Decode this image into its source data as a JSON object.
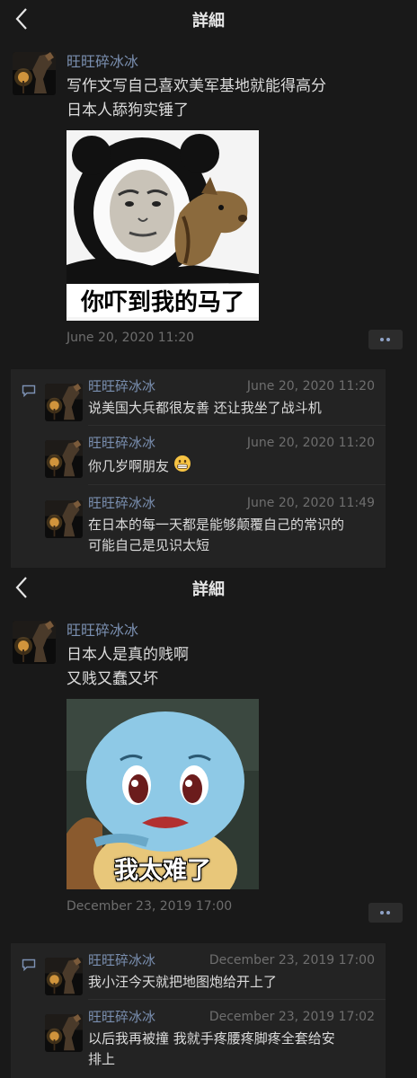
{
  "screens": [
    {
      "nav": {
        "title": "詳細"
      },
      "post": {
        "author": "旺旺碎冰冰",
        "text": [
          "写作文写自己喜欢美军基地就能得高分",
          "日本人舔狗实锤了"
        ],
        "image_caption": "你吓到我的马了",
        "date": "June 20, 2020 11:20"
      },
      "comments": [
        {
          "author": "旺旺碎冰冰",
          "date": "June 20, 2020 11:20",
          "text": [
            "说美国大兵都很友善 还让我坐了战斗机"
          ]
        },
        {
          "author": "旺旺碎冰冰",
          "date": "June 20, 2020 11:20",
          "text": [
            "你几岁啊朋友"
          ],
          "emoji": "grin-emoji"
        },
        {
          "author": "旺旺碎冰冰",
          "date": "June 20, 2020 11:49",
          "text": [
            "在日本的每一天都是能够颠覆自己的常识的",
            "可能自己是见识太短"
          ]
        }
      ]
    },
    {
      "nav": {
        "title": "詳細"
      },
      "post": {
        "author": "旺旺碎冰冰",
        "text": [
          "日本人是真的贱啊",
          "又贱又蠢又坏"
        ],
        "image_caption": "我太难了",
        "date": "December 23, 2019 17:00"
      },
      "comments": [
        {
          "author": "旺旺碎冰冰",
          "date": "December 23, 2019 17:00",
          "text": [
            "我小汪今天就把地图炮给开上了"
          ]
        },
        {
          "author": "旺旺碎冰冰",
          "date": "December 23, 2019 17:02",
          "text": [
            "以后我再被撞 我就手疼腰疼脚疼全套给安",
            "排上"
          ]
        }
      ]
    }
  ],
  "colors": {
    "background": "#191919",
    "comment_bg": "#232323",
    "author": "#7a8fb0",
    "date": "#6e6e6e",
    "text": "#dcdcdc",
    "more_button_dots": "#8fa3c7"
  },
  "icons": [
    "back-arrow-icon",
    "more-dots-icon",
    "comment-bubble-icon",
    "grin-emoji"
  ]
}
